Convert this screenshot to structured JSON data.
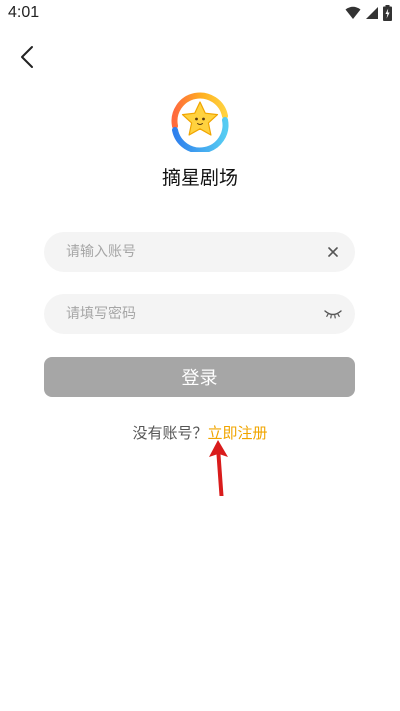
{
  "status_bar": {
    "time": "4:01"
  },
  "app": {
    "title": "摘星剧场"
  },
  "account_field": {
    "placeholder": "请输入账号",
    "value": ""
  },
  "password_field": {
    "placeholder": "请填写密码",
    "value": ""
  },
  "login_button": {
    "label": "登录"
  },
  "register": {
    "prompt": "没有账号？",
    "link": "立即注册"
  },
  "icons": {
    "back": "chevron-left-icon",
    "clear": "close-icon",
    "password_toggle": "eye-closed-icon"
  },
  "colors": {
    "accent": "#f0a500",
    "button_disabled": "#a6a6a6",
    "field_bg": "#f4f4f4",
    "annotation_arrow": "#d91c1c"
  }
}
